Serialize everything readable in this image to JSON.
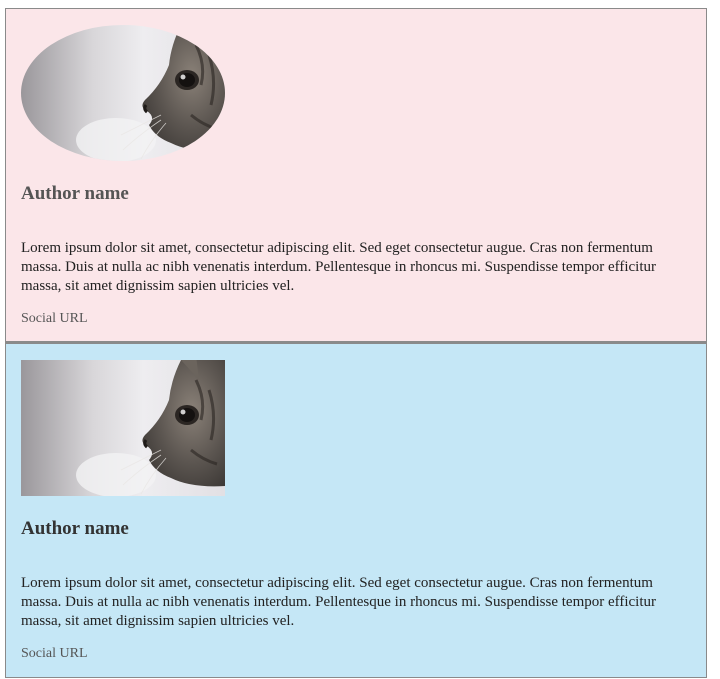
{
  "cards": [
    {
      "author_name": "Author name",
      "bio": "Lorem ipsum dolor sit amet, consectetur adipiscing elit. Sed eget consectetur augue. Cras non fermentum massa. Duis at nulla ac nibh venenatis interdum. Pellentesque in rhoncus mi. Suspendisse tempor efficitur massa, sit amet dignissim sapien ultricies vel.",
      "social_label": "Social URL",
      "avatar_shape": "ellipse",
      "background": "#fbe6e9"
    },
    {
      "author_name": "Author name",
      "bio": "Lorem ipsum dolor sit amet, consectetur adipiscing elit. Sed eget consectetur augue. Cras non fermentum massa. Duis at nulla ac nibh venenatis interdum. Pellentesque in rhoncus mi. Suspendisse tempor efficitur massa, sit amet dignissim sapien ultricies vel.",
      "social_label": "Social URL",
      "avatar_shape": "rectangle",
      "background": "#c5e7f6"
    }
  ]
}
